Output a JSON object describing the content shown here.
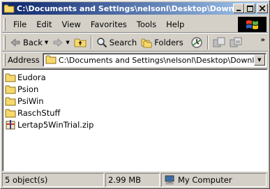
{
  "window": {
    "title": "C:\\Documents and Settings\\nelsonl\\Desktop\\Downloads",
    "title_display": "C:\\Documents and Settings\\nelsonl\\Desktop\\Downl..."
  },
  "menu": {
    "items": [
      "File",
      "Edit",
      "View",
      "Favorites",
      "Tools",
      "Help"
    ]
  },
  "toolbar": {
    "back_label": "Back",
    "search_label": "Search",
    "folders_label": "Folders"
  },
  "address": {
    "label": "Address",
    "value": "C:\\Documents and Settings\\nelsonl\\Desktop\\Downloads"
  },
  "files": [
    {
      "name": "Eudora",
      "type": "folder"
    },
    {
      "name": "Psion",
      "type": "folder"
    },
    {
      "name": "PsiWin",
      "type": "folder"
    },
    {
      "name": "RaschStuff",
      "type": "folder"
    },
    {
      "name": "Lertap5WinTrial.zip",
      "type": "zip"
    }
  ],
  "status": {
    "objects": "5 object(s)",
    "size": "2.99 MB",
    "location": "My Computer"
  },
  "colors": {
    "titlebar_start": "#0a246a",
    "titlebar_end": "#a6caf0",
    "folder": "#f7d96b",
    "chrome": "#d4d0c8"
  }
}
